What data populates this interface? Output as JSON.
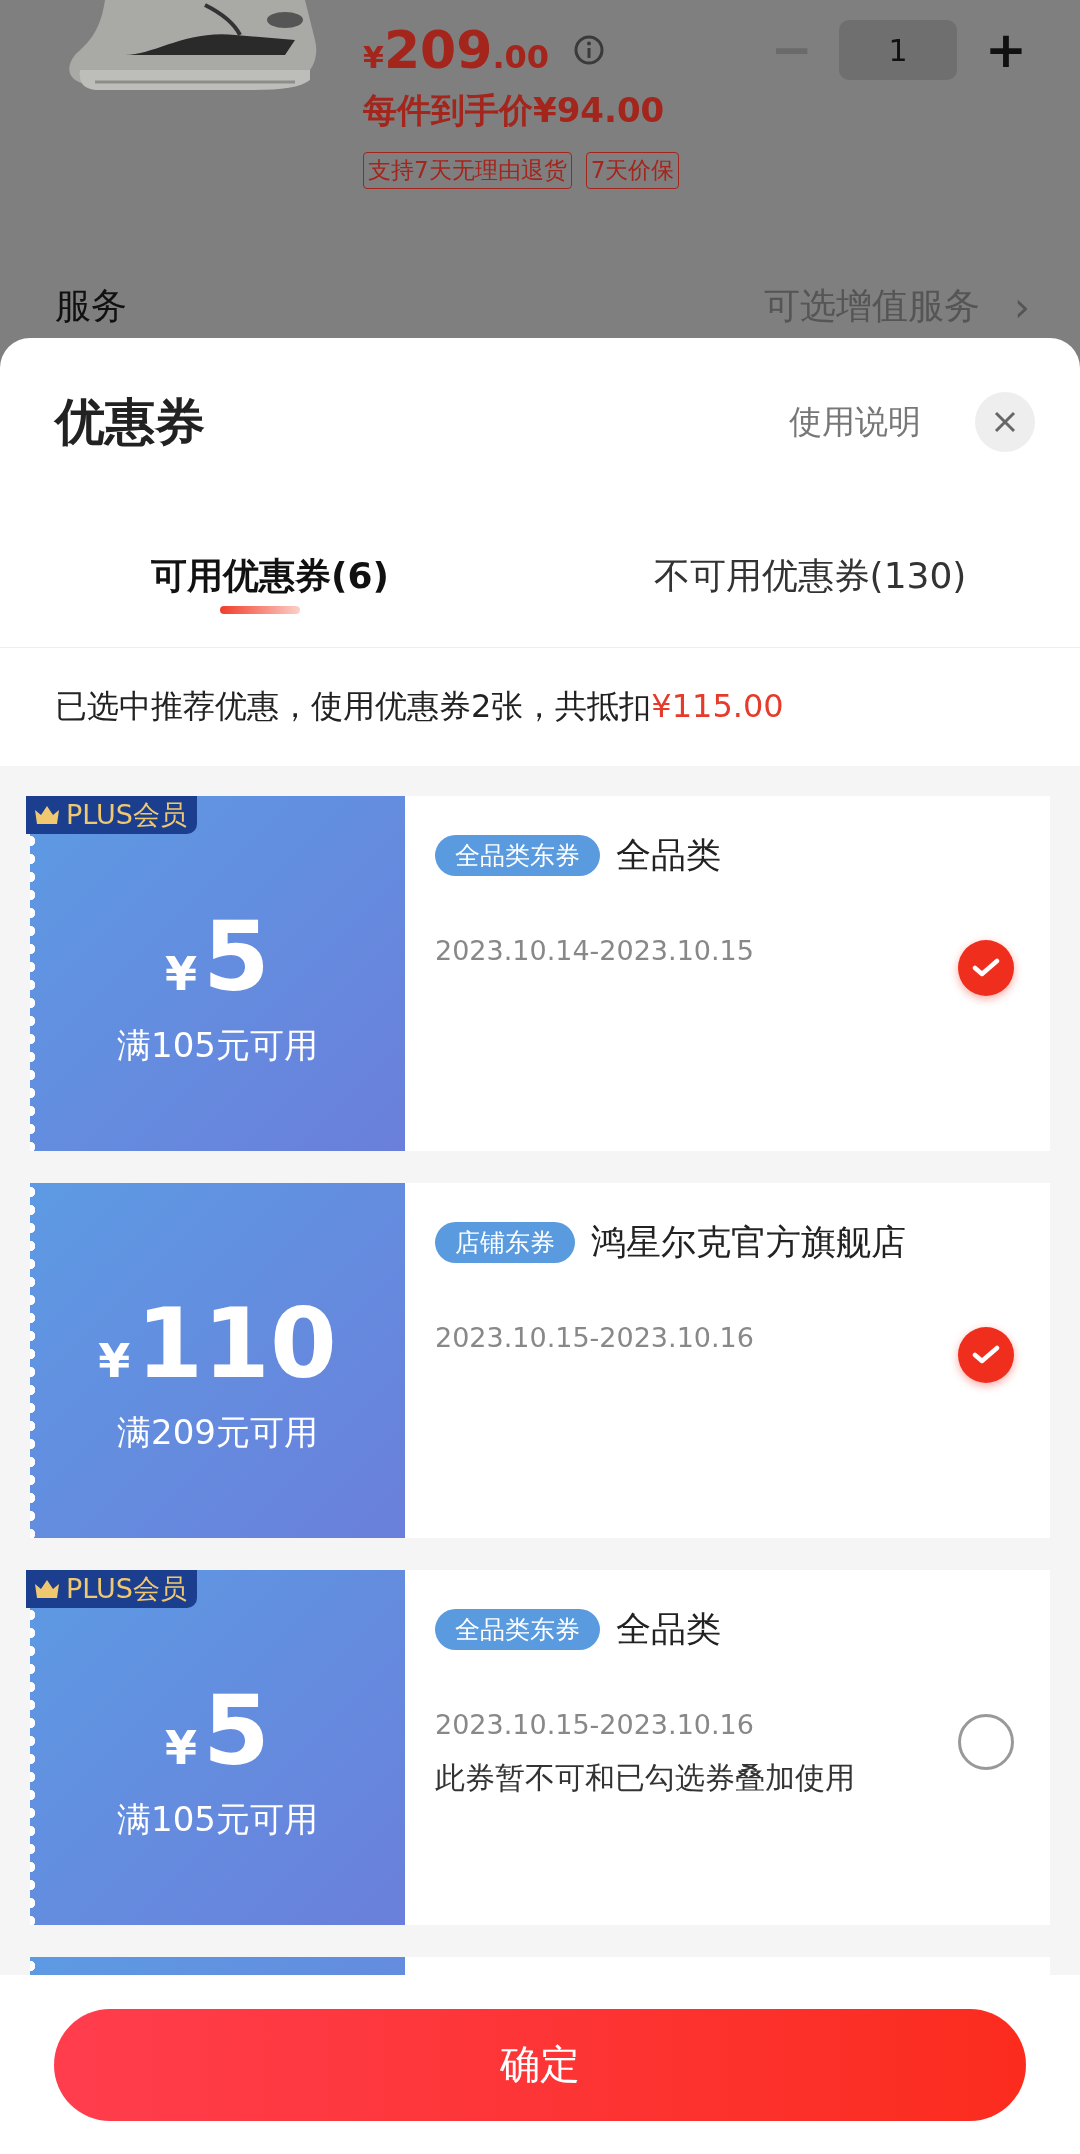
{
  "product": {
    "price_symbol": "¥",
    "price_int": "209",
    "price_dec": ".00",
    "final_price": "每件到手价¥94.00",
    "quantity": "1",
    "minus": "−",
    "plus": "+",
    "tags": [
      "支持7天无理由退货",
      "7天价保"
    ]
  },
  "service": {
    "label": "服务",
    "value": "可选增值服务",
    "chevron": "›"
  },
  "sheet": {
    "title": "优惠券",
    "help": "使用说明"
  },
  "tabs": [
    {
      "label": "可用优惠券(6)",
      "selected": true
    },
    {
      "label": "不可用优惠券(130)",
      "selected": false
    }
  ],
  "summary": {
    "text": "已选中推荐优惠，使用优惠券2张，共抵扣",
    "amount": "¥115.00"
  },
  "coupons": [
    {
      "kind": "full",
      "badge": "PLUS会员",
      "currency": "¥",
      "amount": "5",
      "condition": "满105元可用",
      "tag": "全品类东券",
      "title": "全品类",
      "dates": "2023.10.14-2023.10.15",
      "checked": true
    },
    {
      "kind": "full",
      "currency": "¥",
      "amount": "110",
      "condition": "满209元可用",
      "tag": "店铺东券",
      "title": "鸿星尔克官方旗舰店",
      "dates": "2023.10.15-2023.10.16",
      "checked": true
    },
    {
      "kind": "full",
      "badge": "PLUS会员",
      "currency": "¥",
      "amount": "5",
      "condition": "满105元可用",
      "tag": "全品类东券",
      "title": "全品类",
      "dates": "2023.10.15-2023.10.16",
      "note": "此券暂不可和已勾选券叠加使用",
      "checked": false
    },
    {
      "kind": "partial"
    }
  ],
  "confirm": "确定"
}
